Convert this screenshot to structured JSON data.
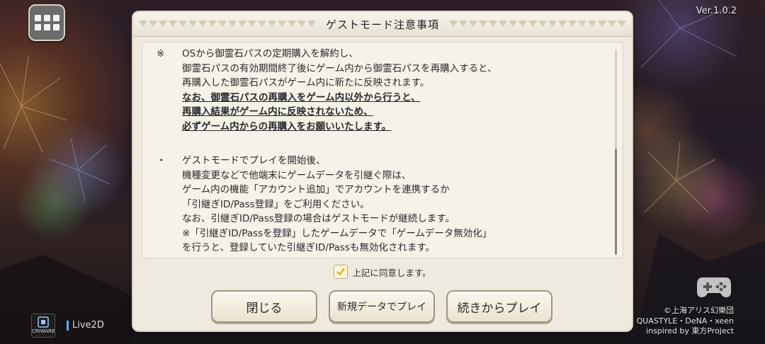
{
  "header": {
    "version": "Ver.1.0.2",
    "menu_icon": "grid-menu-icon"
  },
  "dialog": {
    "title": "ゲストモード注意事項",
    "notice1": {
      "mark": "※",
      "lines": [
        "OSから御霊石パスの定期購入を解約し、",
        "御霊石パスの有効期間終了後にゲーム内から御霊石パスを再購入すると、",
        "再購入した御霊石パスがゲーム内に新たに反映されます。"
      ],
      "bold_lines": [
        "なお、御霊石パスの再購入をゲーム内以外から行うと、",
        "再購入結果がゲーム内に反映されないため、",
        "必ずゲーム内からの再購入をお願いいたします。"
      ]
    },
    "notice2": {
      "mark": "・",
      "lines": [
        "ゲストモードでプレイを開始後、",
        "機種変更などで他端末にゲームデータを引継ぐ際は、",
        "ゲーム内の機能「アカウント追加」でアカウントを連携するか",
        "「引継ぎID/Pass登録」をご利用ください。",
        "なお、引継ぎID/Pass登録の場合はゲストモードが継続します。",
        "※「引継ぎID/Passを登録」したゲームデータで「ゲームデータ無効化」",
        "を行うと、登録していた引継ぎID/Passも無効化されます。"
      ]
    },
    "agree": {
      "label": "上記に同意します。",
      "checked": true
    },
    "buttons": {
      "close": "閉じる",
      "new_play": "新規データでプレイ",
      "continue_play": "続きからプレイ"
    }
  },
  "footer": {
    "cri_logo_text": "CRIWARE",
    "live2d": "Live2D",
    "credits": [
      "©上海アリス幻樂団",
      "QUASTYLE・DeNA・xeen",
      "inspired by 東方Project"
    ]
  },
  "colors": {
    "dialog_bg": "#efeadf",
    "check_color": "#e0a500"
  }
}
